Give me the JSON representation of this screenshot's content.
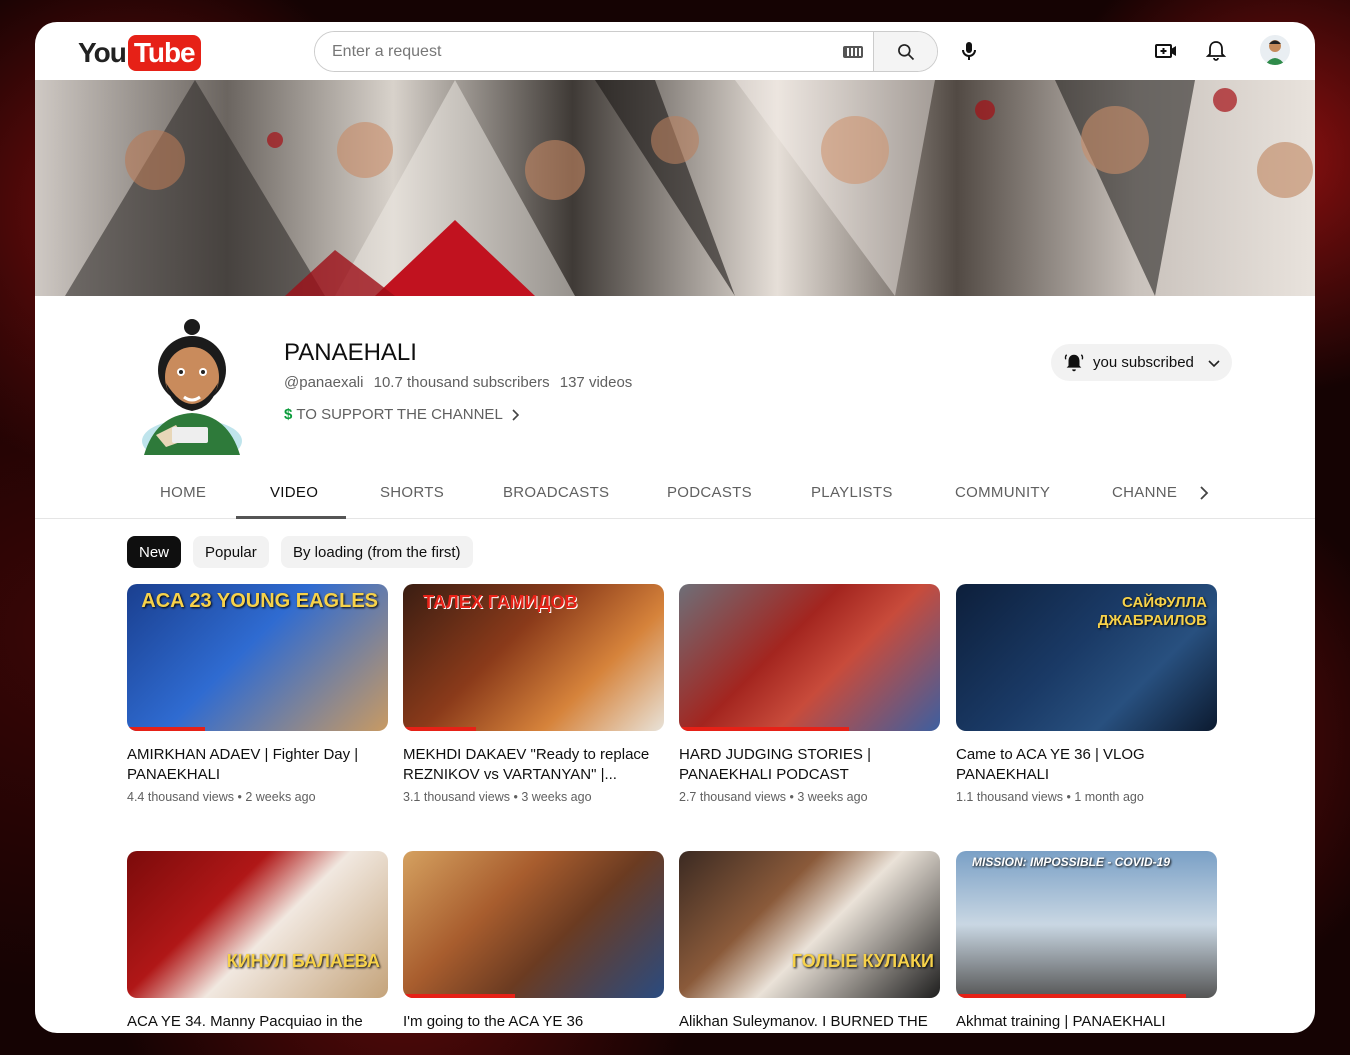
{
  "app": {
    "logo_you": "You",
    "logo_tube": "Tube"
  },
  "search": {
    "placeholder": "Enter a request"
  },
  "channel": {
    "name": "PANAEHALI",
    "handle": "@panaexali",
    "subscribers": "10.7 thousand subscribers",
    "videos_count": "137 videos",
    "support_link": "TO SUPPORT THE CHANNEL",
    "subscribe_label": "you subscribed"
  },
  "tabs": [
    "HOME",
    "VIDEO",
    "SHORTS",
    "BROADCASTS",
    "PODCASTS",
    "PLAYLISTS",
    "COMMUNITY",
    "CHANNE"
  ],
  "chips": [
    "New",
    "Popular",
    "By loading (from the first)"
  ],
  "videos": [
    {
      "title": "AMIRKHAN ADAEV | Fighter Day | PANAEKHALI",
      "views": "4.4 thousand views",
      "age": "2 weeks ago",
      "thumb_text": "ACA 23 YOUNG EAGLES"
    },
    {
      "title": "MEKHDI DAKAEV \"Ready to replace REZNIKOV vs VARTANYAN\" |...",
      "views": "3.1 thousand views",
      "age": "3 weeks ago",
      "thumb_text": "ТАЛЕХ ГАМИДОВ"
    },
    {
      "title": "HARD JUDGING STORIES | PANAEKHALI PODCAST",
      "views": "2.7 thousand views",
      "age": "3 weeks ago",
      "thumb_text": ""
    },
    {
      "title": "Came to ACA YE 36 | VLOG PANAEKHALI",
      "views": "1.1 thousand views",
      "age": "1 month ago",
      "thumb_text": "САЙФУЛЛА ДЖАБРАИЛОВ"
    },
    {
      "title": "ACA YE 34. Manny Pacquiao in the",
      "views": "",
      "age": "",
      "thumb_text": "КИНУЛ БАЛАЕВА"
    },
    {
      "title": "I'm going to the ACA YE 36",
      "views": "",
      "age": "",
      "thumb_text": ""
    },
    {
      "title": "Alikhan Suleymanov. I BURNED THE",
      "views": "",
      "age": "",
      "thumb_text": "ГОЛЫЕ КУЛАКИ"
    },
    {
      "title": "Akhmat training | PANAEKHALI",
      "views": "",
      "age": "",
      "thumb_text": "MISSION: IMPOSSIBLE - COVID-19"
    }
  ],
  "colors": {
    "brand_red": "#e62117",
    "text": "#0f0f0f",
    "muted": "#606060"
  }
}
